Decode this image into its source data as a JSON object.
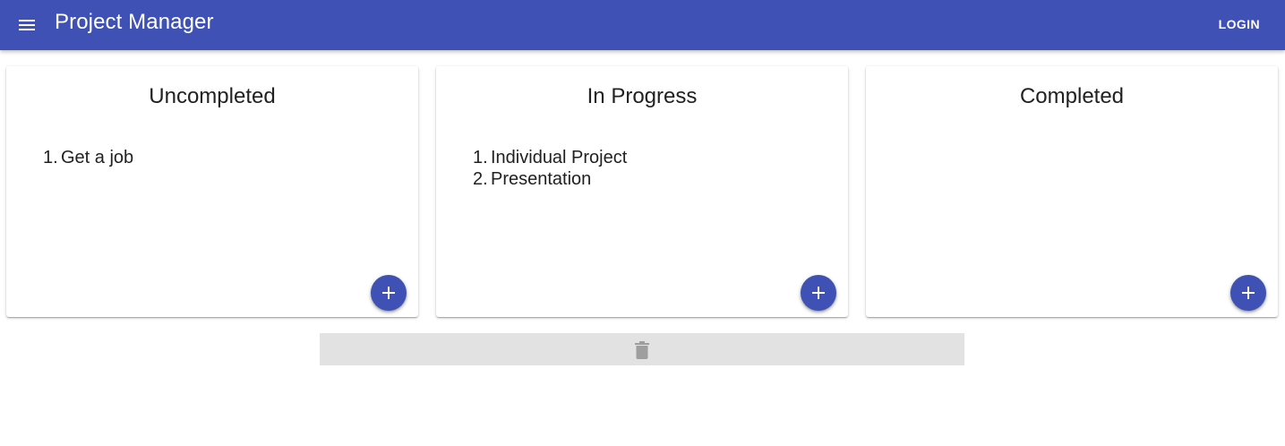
{
  "appbar": {
    "title": "Project Manager",
    "login_label": "LOGIN",
    "menu_icon": "menu-icon",
    "color": "#3f51b5"
  },
  "columns": [
    {
      "title": "Uncompleted",
      "items": [
        {
          "num": "1.",
          "text": "Get a job"
        }
      ]
    },
    {
      "title": "In Progress",
      "items": [
        {
          "num": "1.",
          "text": "Individual Project"
        },
        {
          "num": "2.",
          "text": "Presentation"
        }
      ]
    },
    {
      "title": "Completed",
      "items": []
    }
  ],
  "fab_icon": "plus-icon",
  "trash": {
    "icon": "trash-icon",
    "color": "#e2e2e2"
  }
}
